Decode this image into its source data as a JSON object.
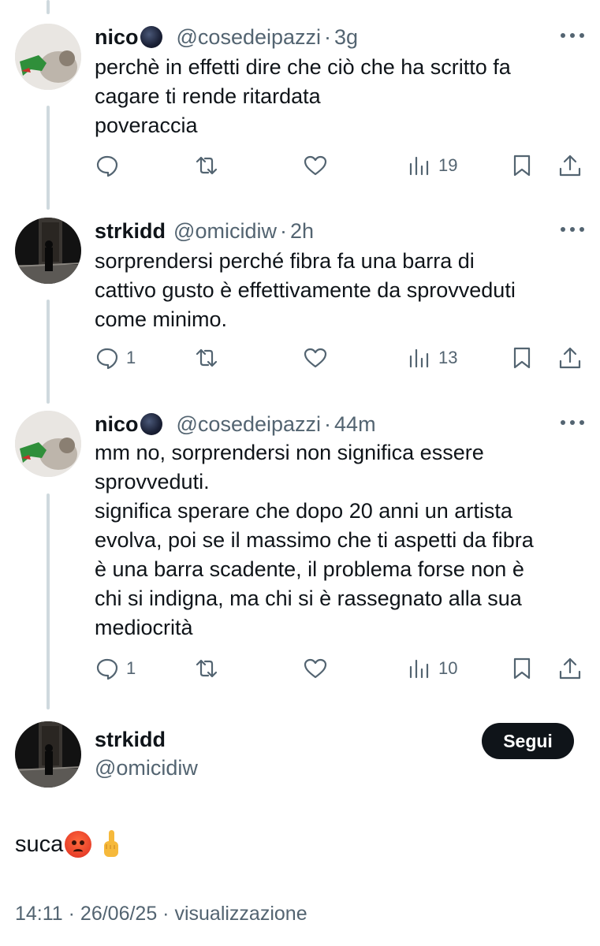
{
  "tweets": [
    {
      "name": "nico",
      "handle": "@cosedeipazzi",
      "time": "3g",
      "lines": [
        "perchè in effetti dire che ciò che ha scritto fa",
        "cagare ti rende ritardata",
        "poveraccia"
      ],
      "replies": "",
      "views": "19"
    },
    {
      "name": "strkidd",
      "handle": "@omicidiw",
      "time": "2h",
      "lines": [
        "sorprendersi perché fibra fa una barra di",
        "cattivo gusto è effettivamente da sprovveduti",
        "come minimo."
      ],
      "replies": "1",
      "views": "13"
    },
    {
      "name": "nico",
      "handle": "@cosedeipazzi",
      "time": "44m",
      "lines": [
        "mm no, sorprendersi non significa essere",
        "sprovveduti.",
        "significa sperare che dopo 20 anni un artista",
        "evolva, poi se il massimo che ti aspetti da fibra",
        "è una barra scadente, il problema forse non è",
        "chi si indigna, ma chi si è rassegnato alla sua",
        "mediocrità"
      ],
      "replies": "1",
      "views": "10"
    }
  ],
  "main": {
    "name": "strkidd",
    "handle": "@omicidiw",
    "follow_label": "Segui",
    "text": "suca",
    "footer": "14:11 · 26/06/25 · visualizzazione"
  },
  "icons": [
    "reply-icon",
    "retweet-icon",
    "like-icon",
    "views-icon",
    "bookmark-icon",
    "share-icon",
    "more-icon"
  ]
}
